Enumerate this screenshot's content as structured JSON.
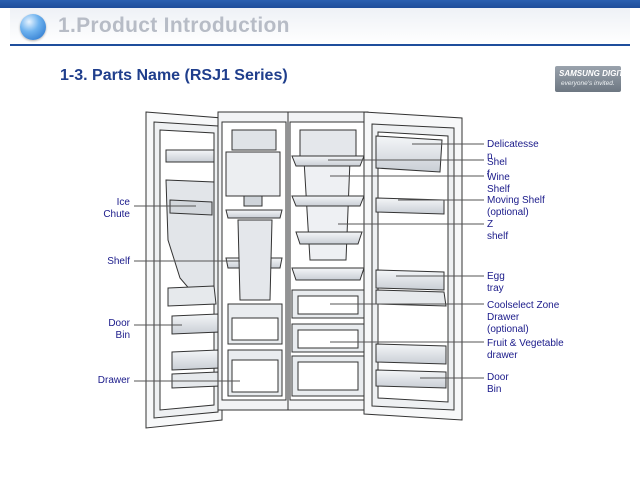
{
  "header": {
    "title": "1.Product Introduction"
  },
  "subtitle": "1-3.  Parts Name (RSJ1 Series)",
  "logo": {
    "brand": "SAMSUNG DIGITall",
    "tagline": "everyone's invited."
  },
  "labels_left": {
    "ice_chute": [
      "Ice",
      "Chute"
    ],
    "shelf": "Shelf",
    "door_bin": [
      "Door",
      "Bin"
    ],
    "drawer": "Drawer"
  },
  "labels_right": {
    "delicatessen": [
      "Delicatesse",
      "n"
    ],
    "shelf": [
      "Shel",
      "f"
    ],
    "wine_shelf": [
      "Wine",
      "Shelf"
    ],
    "moving_shelf": [
      "Moving Shelf",
      "(optional)"
    ],
    "z_shelf": [
      "Z",
      "shelf"
    ],
    "egg_tray": [
      "Egg",
      "tray"
    ],
    "coolselect": [
      "Coolselect Zone",
      "Drawer",
      "(optional)"
    ],
    "fruit_veg": [
      "Fruit & Vegetable",
      "drawer"
    ],
    "door_bin": [
      "Door",
      "Bin"
    ]
  }
}
